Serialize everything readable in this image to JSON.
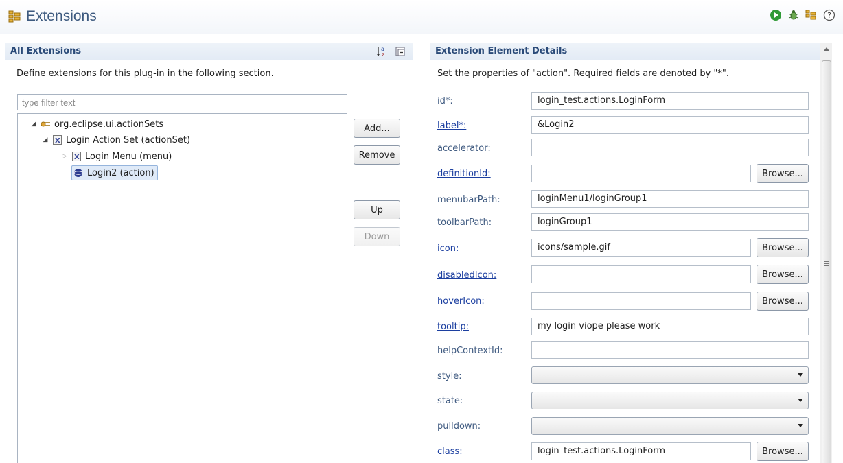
{
  "header": {
    "title": "Extensions",
    "actions": [
      "run-icon",
      "debug-icon",
      "extensions-icon",
      "help-icon"
    ]
  },
  "left": {
    "section_title": "All Extensions",
    "description": "Define extensions for this plug-in in the following section.",
    "filter_placeholder": "type filter text",
    "tree": [
      {
        "label": "org.eclipse.ui.actionSets",
        "icon": "extension-point-icon",
        "expanded": true
      },
      {
        "label": "Login Action Set (actionSet)",
        "icon": "xml-element-icon",
        "expanded": true
      },
      {
        "label": "Login Menu (menu)",
        "icon": "xml-element-icon",
        "expanded": false
      },
      {
        "label": "Login2 (action)",
        "icon": "action-icon",
        "selected": true
      }
    ],
    "buttons": {
      "add": "Add...",
      "remove": "Remove",
      "up": "Up",
      "down": "Down"
    }
  },
  "right": {
    "section_title": "Extension Element Details",
    "description": "Set the properties of \"action\". Required fields are denoted by \"*\".",
    "browse_label": "Browse...",
    "fields": [
      {
        "label": "id*:",
        "value": "login_test.actions.LoginForm"
      },
      {
        "label": "label*:",
        "value": "&Login2"
      },
      {
        "label": "accelerator:",
        "value": ""
      },
      {
        "label": "definitionId:",
        "value": ""
      },
      {
        "label": "menubarPath:",
        "value": "loginMenu1/loginGroup1"
      },
      {
        "label": "toolbarPath:",
        "value": "loginGroup1"
      },
      {
        "label": "icon:",
        "value": "icons/sample.gif"
      },
      {
        "label": "disabledIcon:",
        "value": ""
      },
      {
        "label": "hoverIcon:",
        "value": ""
      },
      {
        "label": "tooltip:",
        "value": "my login viope please work"
      },
      {
        "label": "helpContextId:",
        "value": ""
      },
      {
        "label": "style:",
        "value": ""
      },
      {
        "label": "state:",
        "value": ""
      },
      {
        "label": "pulldown:",
        "value": ""
      },
      {
        "label": "class:",
        "value": "login_test.actions.LoginForm"
      }
    ]
  },
  "colors": {
    "title": "#3d5a7f",
    "section_title": "#2a4a78",
    "link": "#1c3fa0",
    "selection": "#dfeaf8"
  }
}
